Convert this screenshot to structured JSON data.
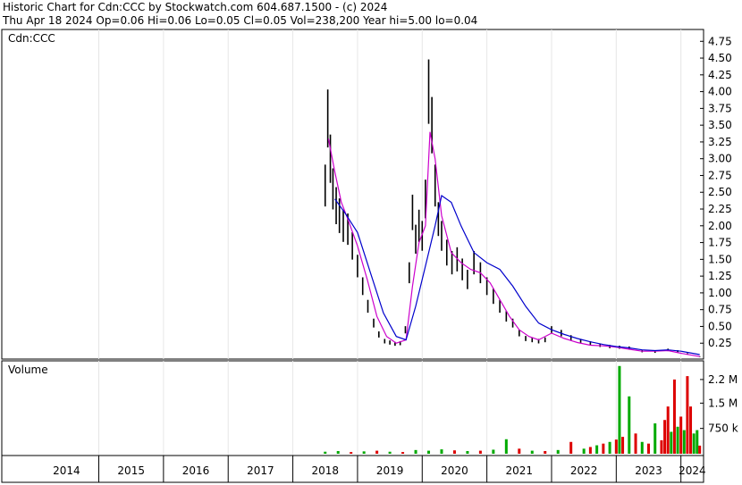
{
  "header": {
    "line1": "Historic Chart for Cdn:CCC by Stockwatch.com 604.687.1500 - (c) 2024",
    "line2": "Thu Apr 18 2024  Op=0.06  Hi=0.06  Lo=0.05  Cl=0.05  Vol=238,200  Year hi=5.00  lo=0.04"
  },
  "price_panel": {
    "symbol_label": "Cdn:CCC"
  },
  "volume_panel": {
    "label": "Volume"
  },
  "colors": {
    "price_bar": "#000000",
    "ma_short": "#cc00cc",
    "ma_long": "#0000cc",
    "volume_up": "#00aa00",
    "volume_down": "#dd0000",
    "volume_flat": "#999999"
  },
  "chart_data": [
    {
      "type": "line",
      "title": "Cdn:CCC price",
      "y_axis_side": "right",
      "ylim": [
        0.04,
        4.9
      ],
      "yticks": [
        "4.75",
        "4.50",
        "4.25",
        "4.00",
        "3.75",
        "3.50",
        "3.25",
        "3.00",
        "2.75",
        "2.50",
        "2.25",
        "2.00",
        "1.75",
        "1.50",
        "1.25",
        "1.00",
        "0.75",
        "0.50",
        "0.25"
      ],
      "x_ticks": [
        "2014",
        "2015",
        "2016",
        "2017",
        "2018",
        "2019",
        "2020",
        "2021",
        "2022",
        "2023",
        "2024"
      ],
      "series": [
        {
          "style": "price-bars",
          "x": [
            2018.5,
            2018.54,
            2018.58,
            2018.62,
            2018.67,
            2018.72,
            2018.78,
            2018.85,
            2018.92,
            2019.0,
            2019.08,
            2019.16,
            2019.25,
            2019.33,
            2019.42,
            2019.5,
            2019.58,
            2019.66,
            2019.74,
            2019.8,
            2019.85,
            2019.9,
            2019.95,
            2020.0,
            2020.05,
            2020.1,
            2020.15,
            2020.2,
            2020.25,
            2020.3,
            2020.38,
            2020.46,
            2020.54,
            2020.62,
            2020.7,
            2020.8,
            2020.9,
            2021.0,
            2021.1,
            2021.2,
            2021.3,
            2021.4,
            2021.5,
            2021.6,
            2021.7,
            2021.8,
            2021.9,
            2022.0,
            2022.15,
            2022.3,
            2022.45,
            2022.6,
            2022.75,
            2022.9,
            2023.05,
            2023.2,
            2023.4,
            2023.6,
            2023.8,
            2023.95,
            2024.1,
            2024.29
          ],
          "y": [
            2.6,
            3.6,
            3.0,
            2.55,
            2.3,
            2.15,
            2.0,
            1.95,
            1.7,
            1.4,
            1.1,
            0.8,
            0.55,
            0.38,
            0.28,
            0.26,
            0.24,
            0.25,
            0.45,
            1.3,
            2.2,
            1.8,
            2.0,
            1.85,
            2.4,
            4.0,
            3.5,
            2.6,
            2.1,
            1.85,
            1.6,
            1.45,
            1.5,
            1.35,
            1.2,
            1.45,
            1.3,
            1.1,
            0.95,
            0.8,
            0.65,
            0.55,
            0.4,
            0.32,
            0.3,
            0.28,
            0.3,
            0.45,
            0.4,
            0.33,
            0.28,
            0.25,
            0.22,
            0.2,
            0.19,
            0.18,
            0.13,
            0.12,
            0.15,
            0.13,
            0.09,
            0.05
          ]
        },
        {
          "name": "Short moving average",
          "x": [
            2018.55,
            2018.65,
            2018.75,
            2018.85,
            2019.0,
            2019.15,
            2019.3,
            2019.45,
            2019.6,
            2019.75,
            2019.85,
            2019.95,
            2020.05,
            2020.12,
            2020.2,
            2020.3,
            2020.45,
            2020.6,
            2020.75,
            2020.9,
            2021.05,
            2021.2,
            2021.35,
            2021.5,
            2021.65,
            2021.8,
            2022.0,
            2022.2,
            2022.4,
            2022.6,
            2022.8,
            2023.0,
            2023.2,
            2023.4,
            2023.6,
            2023.8,
            2024.0,
            2024.29
          ],
          "y": [
            3.3,
            2.8,
            2.35,
            2.1,
            1.7,
            1.2,
            0.65,
            0.35,
            0.25,
            0.3,
            1.1,
            1.75,
            2.0,
            3.4,
            3.0,
            2.15,
            1.6,
            1.45,
            1.35,
            1.3,
            1.15,
            0.9,
            0.65,
            0.45,
            0.35,
            0.3,
            0.4,
            0.32,
            0.26,
            0.22,
            0.21,
            0.19,
            0.16,
            0.13,
            0.13,
            0.14,
            0.1,
            0.05
          ]
        },
        {
          "name": "Long moving average",
          "x": [
            2018.65,
            2018.8,
            2019.0,
            2019.2,
            2019.4,
            2019.6,
            2019.75,
            2019.9,
            2020.05,
            2020.2,
            2020.3,
            2020.45,
            2020.6,
            2020.8,
            2021.0,
            2021.2,
            2021.4,
            2021.6,
            2021.8,
            2022.0,
            2022.2,
            2022.4,
            2022.6,
            2022.8,
            2023.0,
            2023.2,
            2023.4,
            2023.6,
            2023.8,
            2024.0,
            2024.29
          ],
          "y": [
            2.4,
            2.2,
            1.9,
            1.3,
            0.7,
            0.35,
            0.3,
            0.8,
            1.4,
            2.0,
            2.45,
            2.35,
            2.0,
            1.6,
            1.45,
            1.35,
            1.1,
            0.8,
            0.55,
            0.45,
            0.38,
            0.32,
            0.27,
            0.23,
            0.2,
            0.18,
            0.15,
            0.14,
            0.15,
            0.13,
            0.08
          ]
        }
      ]
    },
    {
      "type": "bar",
      "title": "Volume",
      "y_axis_side": "right",
      "ylim": [
        0,
        2700000
      ],
      "yticks": [
        "2.2 M",
        "1.5 M",
        "750 k"
      ],
      "x": [
        2018.5,
        2018.7,
        2018.9,
        2019.1,
        2019.3,
        2019.5,
        2019.7,
        2019.9,
        2020.1,
        2020.3,
        2020.5,
        2020.7,
        2020.9,
        2021.1,
        2021.3,
        2021.5,
        2021.7,
        2021.9,
        2022.1,
        2022.3,
        2022.5,
        2022.6,
        2022.7,
        2022.8,
        2022.9,
        2023.0,
        2023.05,
        2023.1,
        2023.2,
        2023.3,
        2023.4,
        2023.5,
        2023.6,
        2023.7,
        2023.75,
        2023.8,
        2023.85,
        2023.9,
        2023.95,
        2024.0,
        2024.05,
        2024.1,
        2024.15,
        2024.2,
        2024.25,
        2024.29
      ],
      "values": [
        60000,
        80000,
        50000,
        70000,
        90000,
        60000,
        50000,
        110000,
        90000,
        130000,
        100000,
        80000,
        90000,
        120000,
        430000,
        150000,
        90000,
        80000,
        110000,
        350000,
        150000,
        200000,
        250000,
        300000,
        350000,
        420000,
        2600000,
        500000,
        1700000,
        600000,
        350000,
        300000,
        900000,
        400000,
        1000000,
        1400000,
        650000,
        2200000,
        800000,
        1100000,
        700000,
        2300000,
        1400000,
        600000,
        700000,
        240000
      ],
      "directions": [
        "up",
        "up",
        "down",
        "up",
        "down",
        "up",
        "down",
        "up",
        "up",
        "up",
        "down",
        "up",
        "down",
        "up",
        "up",
        "down",
        "up",
        "down",
        "up",
        "down",
        "up",
        "down",
        "up",
        "down",
        "up",
        "down",
        "up",
        "down",
        "up",
        "down",
        "up",
        "down",
        "up",
        "down",
        "down",
        "down",
        "up",
        "down",
        "up",
        "down",
        "up",
        "down",
        "down",
        "up",
        "up",
        "down"
      ]
    }
  ]
}
